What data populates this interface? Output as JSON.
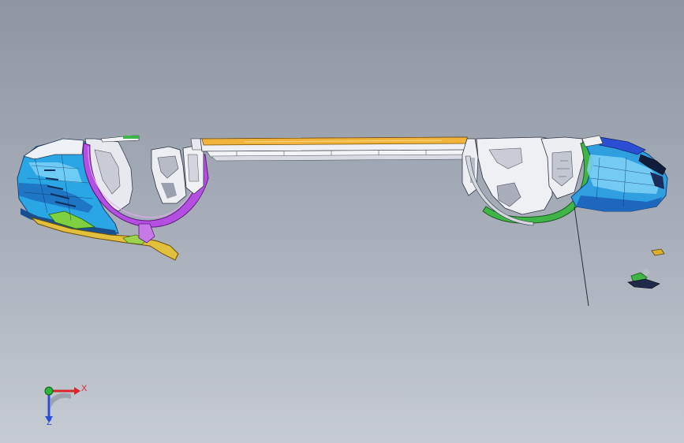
{
  "viewport": {
    "background_top": "#8d96a3",
    "background_bottom": "#c6cbd3"
  },
  "triad": {
    "x_label": "X",
    "z_label": "Z",
    "x_color": "#d8262b",
    "y_color": "#27b53a",
    "z_color": "#2b4fd2"
  },
  "model": {
    "parts": [
      {
        "name": "front-bumper-assembly",
        "color": "#2aa6e3"
      },
      {
        "name": "front-wheelhouse-arch",
        "color": "#b04fe0"
      },
      {
        "name": "roof-side-rail",
        "color": "#f0b43c"
      },
      {
        "name": "rear-wheelhouse-arch",
        "color": "#3fb548"
      },
      {
        "name": "rear-bumper-assembly",
        "color": "#2f9fe0"
      },
      {
        "name": "front-lower-splitter",
        "color": "#e0b83a"
      },
      {
        "name": "front-fender-bracket",
        "color": "#7fd040"
      },
      {
        "name": "rear-detached-bracket",
        "color": "#d8b02c"
      }
    ]
  }
}
